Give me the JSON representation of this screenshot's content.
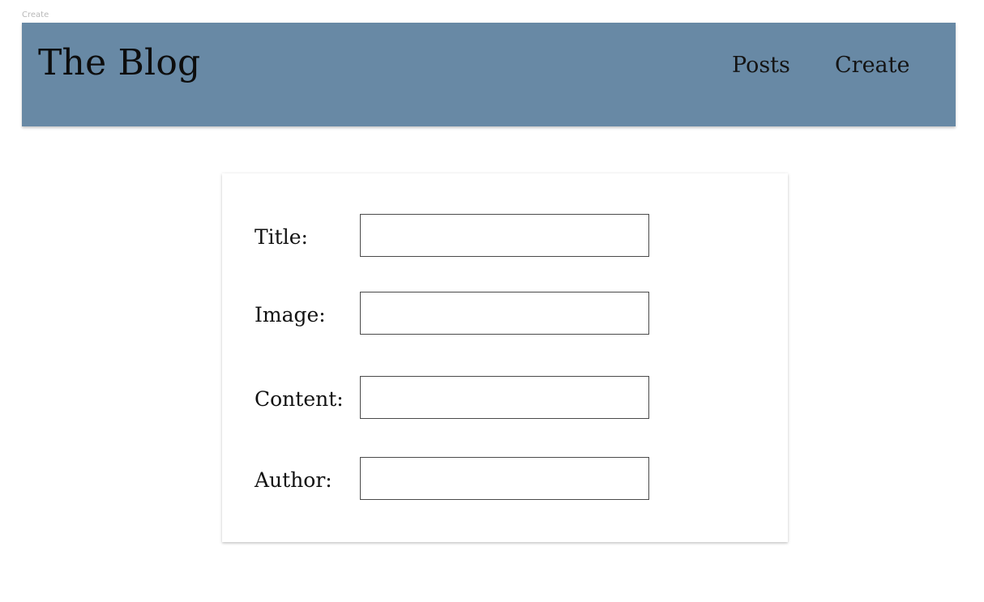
{
  "frame": {
    "label": "Create"
  },
  "header": {
    "brand": "The Blog",
    "nav": [
      {
        "label": "Posts"
      },
      {
        "label": "Create"
      }
    ],
    "background_color": "#6889a5"
  },
  "form": {
    "fields": [
      {
        "label": "Title:",
        "value": ""
      },
      {
        "label": "Image:",
        "value": ""
      },
      {
        "label": "Content:",
        "value": ""
      },
      {
        "label": "Author:",
        "value": ""
      }
    ]
  }
}
